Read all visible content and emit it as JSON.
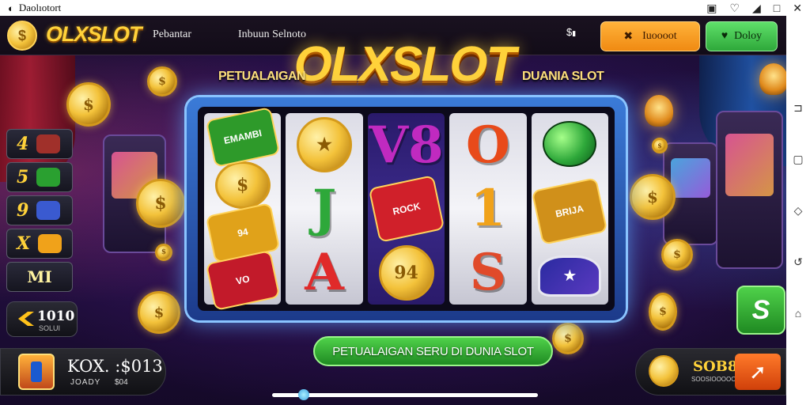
{
  "status_bar": {
    "app_label": "Daolıotort",
    "icons": [
      "screen-record-icon",
      "vpn-icon",
      "signal-icon",
      "recents-square-icon",
      "close-icon"
    ]
  },
  "header": {
    "logo_text": "OLXSLOT",
    "nav": [
      "Pebantar",
      "Inbuun Selnoto"
    ],
    "icon_label": "SLSI",
    "orange_button": "Iuoooot",
    "green_button": "Doloy"
  },
  "hero": {
    "title": "OLXSLOT",
    "tagline_left": "PETUALAIGAN",
    "tagline_right": "DUANIA SLOT"
  },
  "reels": [
    [
      {
        "kind": "banner",
        "text": "EMAMBI",
        "bg": "#2e9a2a"
      },
      {
        "kind": "coin",
        "text": "$"
      },
      {
        "kind": "banner",
        "text": "94",
        "bg": "#e0a21a"
      },
      {
        "kind": "banner",
        "text": "VO",
        "bg": "#c21a2a"
      }
    ],
    [
      {
        "kind": "coin",
        "text": "★"
      },
      {
        "kind": "letter",
        "text": "J",
        "color": "#2ea83a"
      },
      {
        "kind": "letter",
        "text": "A",
        "color": "#e02a2a"
      }
    ],
    [
      {
        "kind": "letter",
        "text": "V8",
        "color": "#c02ac0"
      },
      {
        "kind": "banner",
        "text": "ROCK",
        "bg": "#d0202a"
      },
      {
        "kind": "coin",
        "text": "94"
      }
    ],
    [
      {
        "kind": "letter",
        "text": "O",
        "color": "#e84a1a"
      },
      {
        "kind": "letter",
        "text": "1",
        "color": "#f0a21a"
      },
      {
        "kind": "letter",
        "text": "S",
        "color": "#e04a2a"
      }
    ],
    [
      {
        "kind": "gem",
        "text": ""
      },
      {
        "kind": "banner",
        "text": "BRIJA",
        "bg": "#d0901a"
      },
      {
        "kind": "hat",
        "text": "★"
      }
    ]
  ],
  "side_panel": [
    {
      "num": "4",
      "icon_color": "#a0302a"
    },
    {
      "num": "5",
      "icon_color": "#2aa030"
    },
    {
      "num": "9",
      "icon_color": "#3a5ad0"
    },
    {
      "num": "X",
      "icon_color": "#f0a21a"
    },
    {
      "num": "MI",
      "icon_color": ""
    }
  ],
  "credit": {
    "value": "1010",
    "sub": "SOLUI"
  },
  "banner": "PETUALAIGAN SERU DI DUNIA SLOT",
  "bottom_left": {
    "title": "KOX. :$013",
    "sub1": "JOADY",
    "sub2": "$04"
  },
  "bottom_right": {
    "value": "SOB8",
    "sub": "SOOSIOOOOOOOOOO"
  },
  "side_green_label": "S",
  "colors": {
    "gold": "#ffd23a",
    "orange": "#f08a12",
    "green": "#2ea83a",
    "machine_blue": "#3b7bd8"
  }
}
